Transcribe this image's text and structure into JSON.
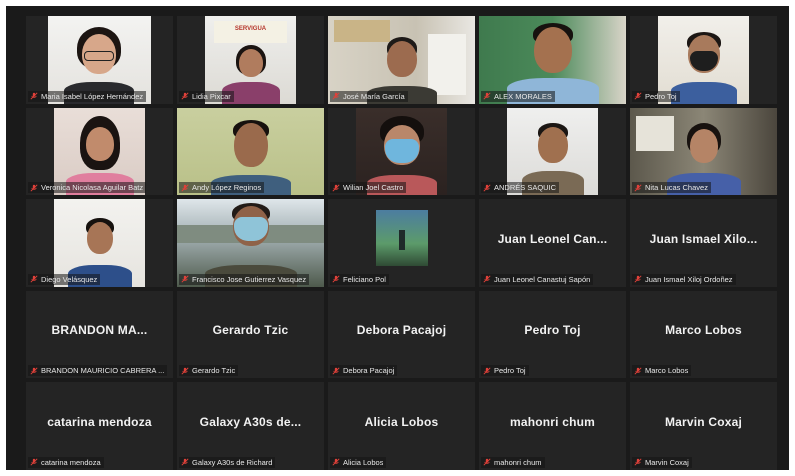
{
  "colors": {
    "background": "#1a1a1a",
    "tile": "#242424",
    "muted_mic": "#e0413a",
    "name_text": "#f2f2f2"
  },
  "icons": {
    "label_icon": "muted-mic-icon"
  },
  "tiles": [
    {
      "label": "Maria Isabel López Hernández"
    },
    {
      "label": "Lidia Pixcar",
      "sign": "SERVIGUA"
    },
    {
      "label": "José María García"
    },
    {
      "label": "ALEX MORALES"
    },
    {
      "label": "Pedro Toj"
    },
    {
      "label": "Veronica Nicolasa Aguilar Batz"
    },
    {
      "label": "Andy López Reginos"
    },
    {
      "label": "Wilian Joel Castro"
    },
    {
      "label": "ANDRÉS SAQUIC"
    },
    {
      "label": "Nita Lucas Chavez"
    },
    {
      "label": "Diego Velásquez"
    },
    {
      "label": "Francisco Jose Gutierrez Vasquez"
    },
    {
      "label": "Feliciano Pol"
    },
    {
      "label": "Juan Leonel Canastuj Sapón",
      "display": "Juan Leonel Can..."
    },
    {
      "label": "Juan Ismael Xiloj Ordoñez",
      "display": "Juan Ismael Xilo..."
    },
    {
      "label": "BRANDON MAURICIO CABRERA ...",
      "display": "BRANDON MA..."
    },
    {
      "label": "Gerardo Tzic",
      "display": "Gerardo Tzic"
    },
    {
      "label": "Debora Pacajoj",
      "display": "Debora Pacajoj"
    },
    {
      "label": "Pedro Toj",
      "display": "Pedro Toj"
    },
    {
      "label": "Marco Lobos",
      "display": "Marco Lobos"
    },
    {
      "label": "catarina mendoza",
      "display": "catarina mendoza"
    },
    {
      "label": "Galaxy A30s de Richard",
      "display": "Galaxy A30s de..."
    },
    {
      "label": "Alicia Lobos",
      "display": "Alicia Lobos"
    },
    {
      "label": "mahonri chum",
      "display": "mahonri chum"
    },
    {
      "label": "Marvin Coxaj",
      "display": "Marvin Coxaj"
    }
  ]
}
